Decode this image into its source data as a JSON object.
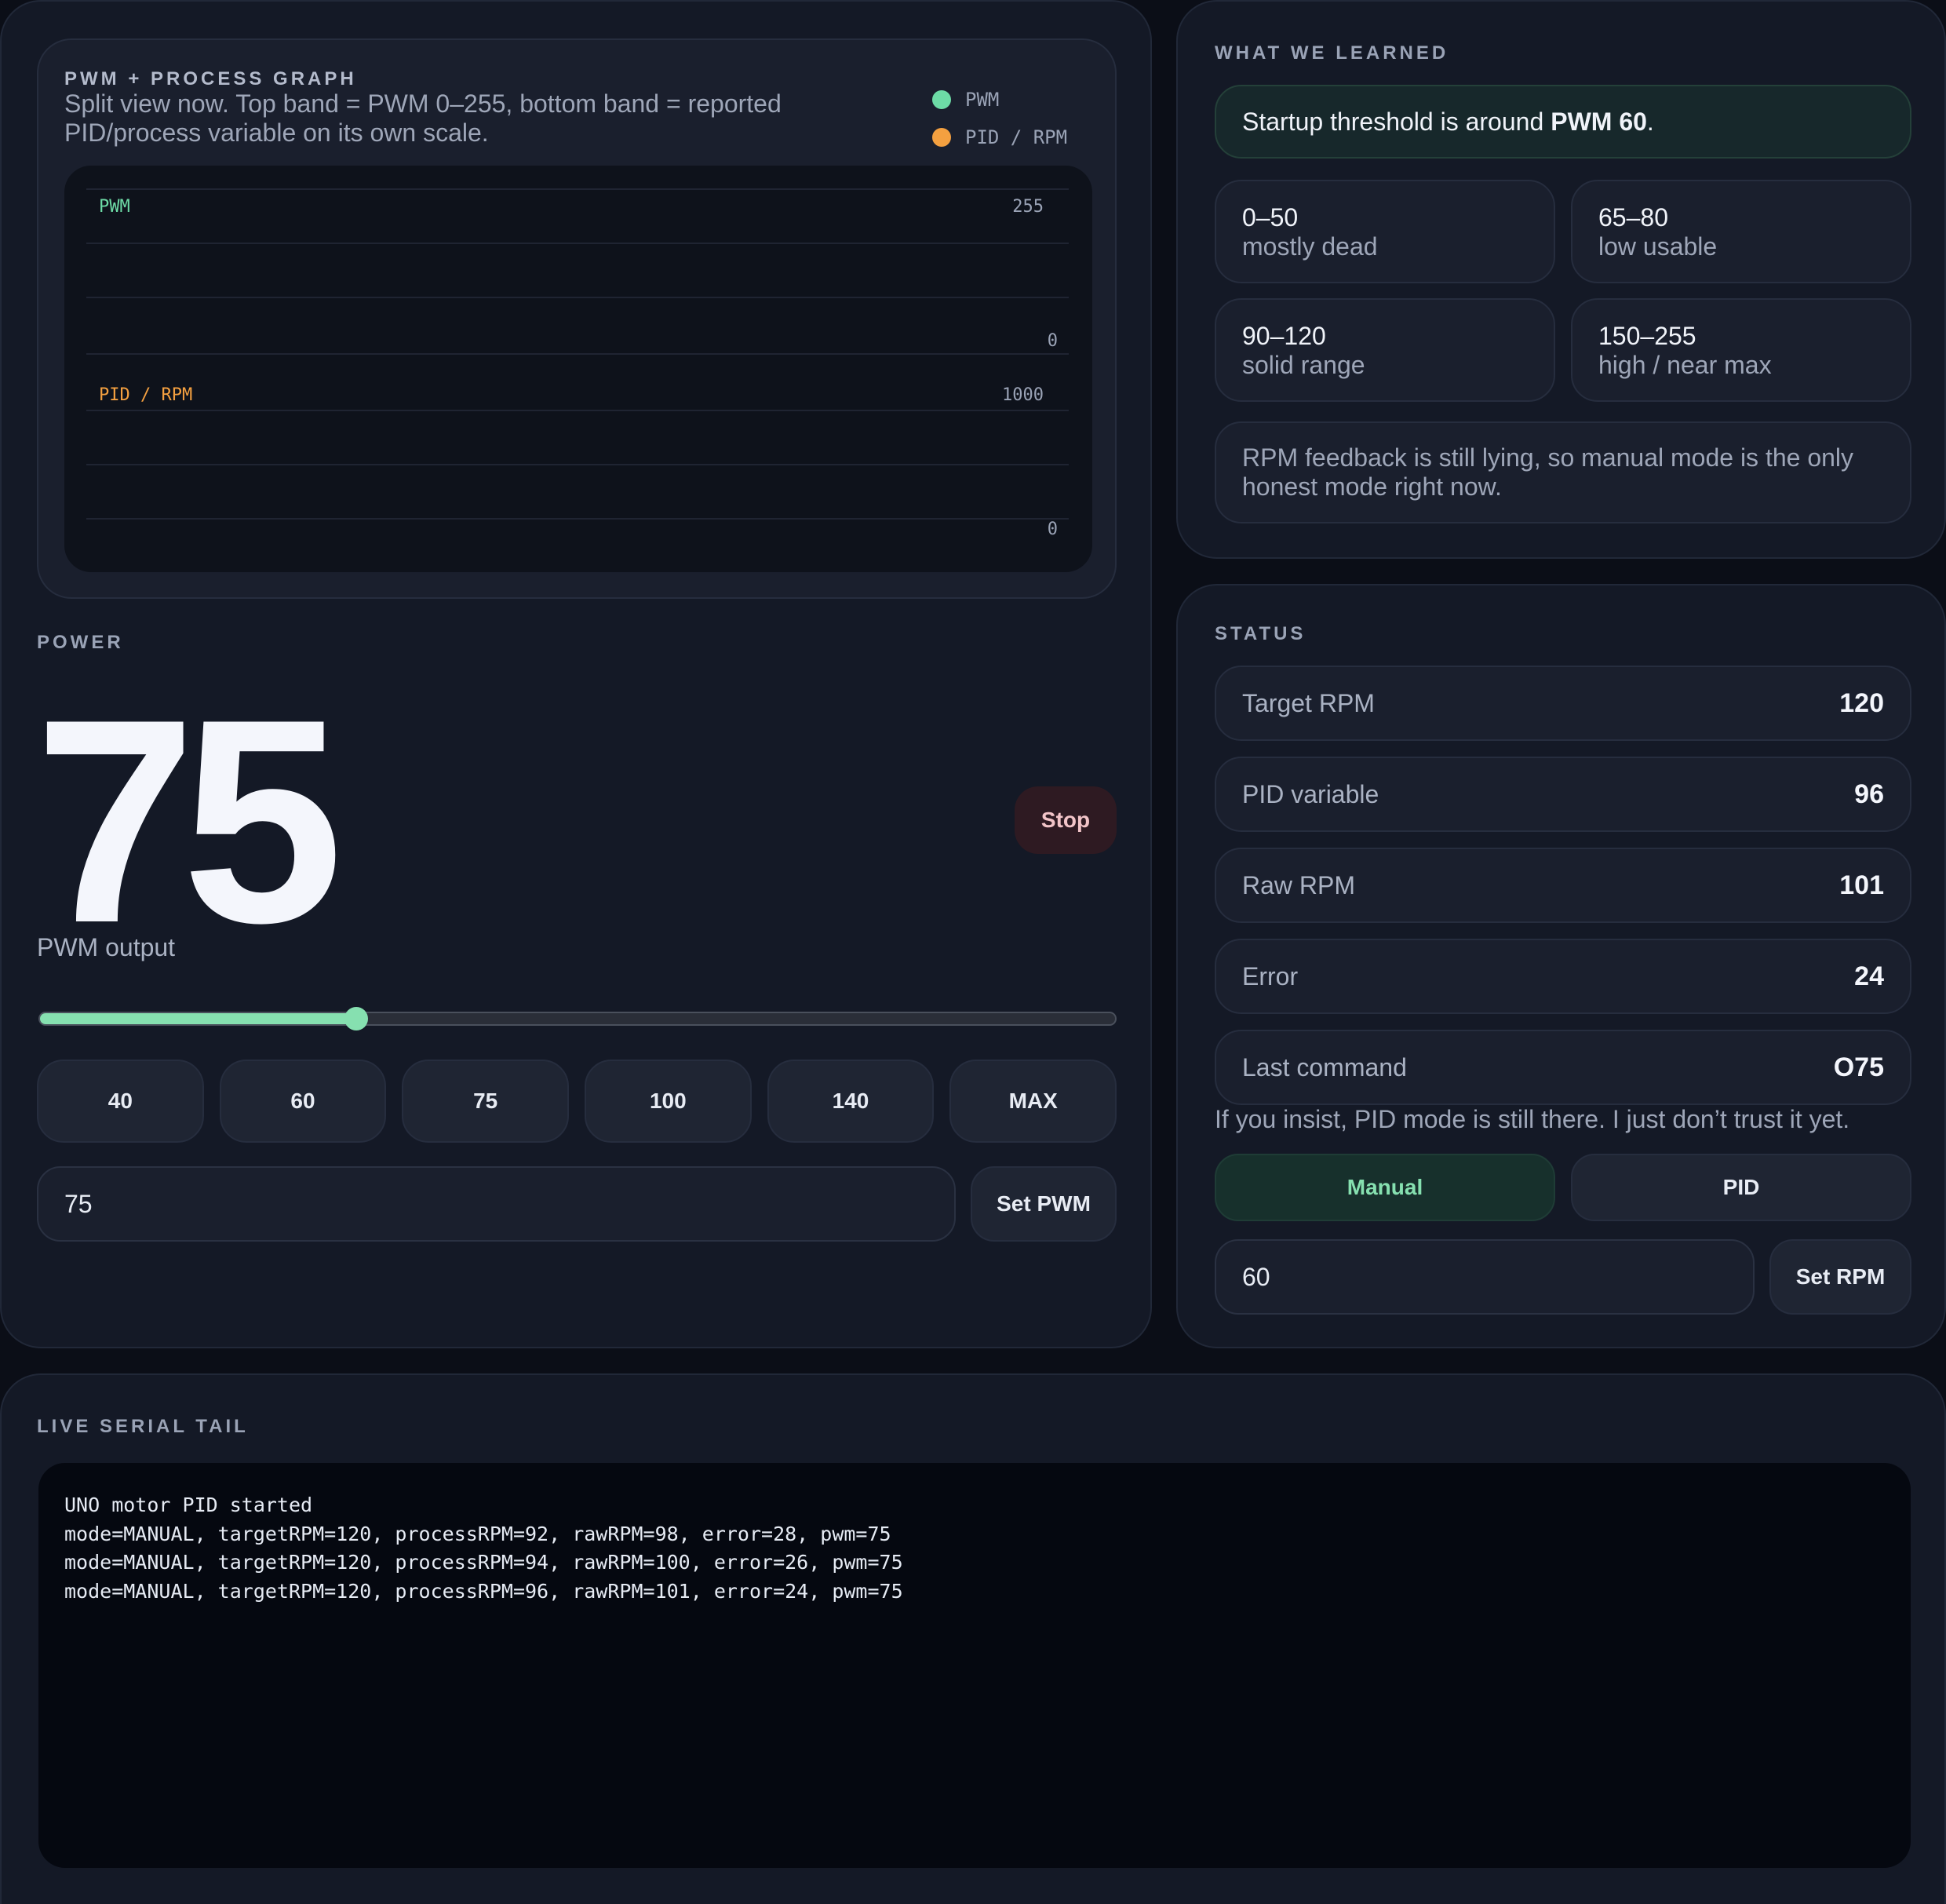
{
  "graph": {
    "title": "PWM + PROCESS GRAPH",
    "description": "Split view now. Top band = PWM 0–255, bottom band = reported PID/process variable on its own scale.",
    "legend": [
      {
        "label": "PWM",
        "color": "#6ddba6"
      },
      {
        "label": "PID / RPM",
        "color": "#f4a040"
      }
    ],
    "bands": [
      {
        "label": "PWM",
        "max_label": "255",
        "min_label": "0",
        "color": "#6ddba6"
      },
      {
        "label": "PID / RPM",
        "max_label": "1000",
        "min_label": "0",
        "color": "#f4a040"
      }
    ]
  },
  "power": {
    "section_label": "POWER",
    "value": "75",
    "caption": "PWM output",
    "stop_label": "Stop",
    "slider": {
      "value": 75,
      "min": 0,
      "max": 255
    },
    "presets": [
      "40",
      "60",
      "75",
      "100",
      "140",
      "MAX"
    ],
    "input_value": "75",
    "set_label": "Set PWM"
  },
  "learned": {
    "section_label": "WHAT WE LEARNED",
    "threshold_prefix": "Startup threshold is around",
    "threshold_value": "PWM 60",
    "threshold_suffix": ".",
    "ranges": [
      {
        "range": "0–50",
        "desc": "mostly dead"
      },
      {
        "range": "65–80",
        "desc": "low usable"
      },
      {
        "range": "90–120",
        "desc": "solid range"
      },
      {
        "range": "150–255",
        "desc": "high / near max"
      }
    ],
    "feedback_note": "RPM feedback is still lying, so manual mode is the only honest mode right now."
  },
  "status": {
    "section_label": "STATUS",
    "rows": [
      {
        "label": "Target RPM",
        "value": "120"
      },
      {
        "label": "PID variable",
        "value": "96"
      },
      {
        "label": "Raw RPM",
        "value": "101"
      },
      {
        "label": "Error",
        "value": "24"
      },
      {
        "label": "Last command",
        "value": "O75"
      }
    ],
    "pid_note": "If you insist, PID mode is still there. I just don’t trust it yet.",
    "mode_manual": "Manual",
    "mode_pid": "PID",
    "rpm_input_value": "60",
    "set_rpm_label": "Set RPM"
  },
  "serial": {
    "section_label": "LIVE SERIAL TAIL",
    "lines": [
      "UNO motor PID started",
      "mode=MANUAL, targetRPM=120, processRPM=92, rawRPM=98, error=28, pwm=75",
      "mode=MANUAL, targetRPM=120, processRPM=94, rawRPM=100, error=26, pwm=75",
      "mode=MANUAL, targetRPM=120, processRPM=96, rawRPM=101, error=24, pwm=75"
    ]
  }
}
